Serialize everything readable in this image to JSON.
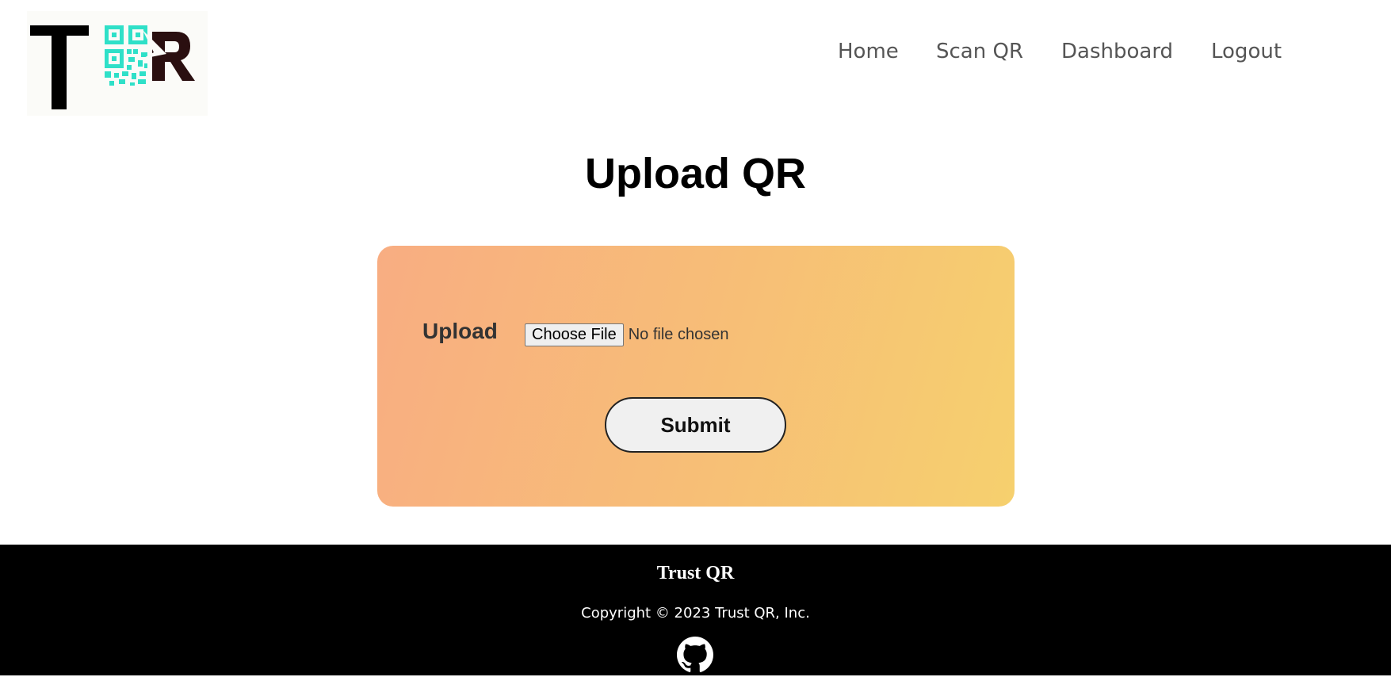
{
  "header": {
    "logo": {
      "letters": [
        "T",
        "R"
      ],
      "colors": {
        "dark": "#000000",
        "qr": "#2fe0c8",
        "accent": "#2a0f10"
      }
    },
    "nav": {
      "home": "Home",
      "scan_qr": "Scan QR",
      "dashboard": "Dashboard",
      "logout": "Logout"
    }
  },
  "main": {
    "title": "Upload QR",
    "form": {
      "upload_label": "Upload",
      "choose_file_label": "Choose File",
      "file_status": "No file chosen",
      "submit_label": "Submit"
    },
    "card_colors": {
      "gradient_start": "#f8ad82",
      "gradient_end": "#f6d06e"
    }
  },
  "footer": {
    "brand": "Trust QR",
    "copyright": "Copyright © 2023 Trust QR, Inc.",
    "social_icon": "github-icon"
  }
}
